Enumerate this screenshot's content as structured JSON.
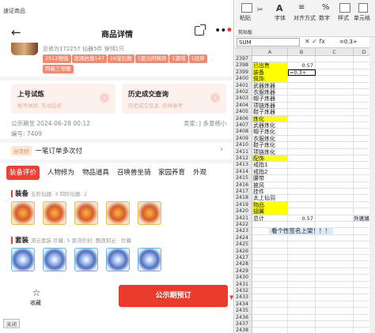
{
  "left": {
    "top_label": "速证商品",
    "header": {
      "title": "商品详情"
    },
    "stats": "总修为172257  仙器5件  穿翎1只",
    "tags": [
      "2512物值",
      "改观抗值147",
      "16宝石数",
      "1套元的佩饰",
      "1游戏",
      "1段穿",
      "四级三觉醒"
    ],
    "cards": [
      {
        "title": "上号试炼",
        "sub": "账号体验, 先试后买"
      },
      {
        "title": "历史成交查询",
        "sub": "历史成交信息, 仅供参考"
      }
    ],
    "publish_time": "公示期至 2024-06-28 00:12",
    "seller": "卖家: J 多意杨小",
    "server": "编号: 7409",
    "install": {
      "badge": "分次付",
      "text": "一笔订单多次付"
    },
    "tabs": [
      "装备评价",
      "人物修为",
      "物品道具",
      "召唤兽坐骑",
      "家园养育",
      "外观"
    ],
    "equip": {
      "title": "装备",
      "sub": "五阶仙器: 3  四阶仙器: 2"
    },
    "set": {
      "title": "套装",
      "sub": "游云套装  珍藏: 5  漱流珍封: 飘逸知云 · 珍藏"
    },
    "bottom": {
      "fav": "收藏",
      "buy": "公示期预订"
    },
    "status": "关闭"
  },
  "right": {
    "ribbon": {
      "paste": "粘贴",
      "clipboard": "剪贴板",
      "font": "字体",
      "align": "对齐方式",
      "number": "数字",
      "style": "样式",
      "cell": "单元格"
    },
    "namebox": "SUM",
    "fx": "✕ ✓ fx",
    "formula": "=0.3+",
    "cols": [
      "A",
      "B",
      "C",
      "D"
    ],
    "rows": [
      {
        "n": "2397",
        "a": "",
        "b": "",
        "y": false
      },
      {
        "n": "2398",
        "a": "已出售",
        "b": "0.57",
        "y": true
      },
      {
        "n": "2399",
        "a": "装备",
        "b": "=0.3+",
        "y": true,
        "edit": true
      },
      {
        "n": "2400",
        "a": "佩饰",
        "b": "",
        "y": true
      },
      {
        "n": "2401",
        "a": "武器炼器",
        "b": "",
        "y": false
      },
      {
        "n": "2402",
        "a": "衣服炼器",
        "b": "",
        "y": false
      },
      {
        "n": "2403",
        "a": "帽子炼器",
        "b": "",
        "y": false
      },
      {
        "n": "2404",
        "a": "项链炼器",
        "b": "",
        "y": false
      },
      {
        "n": "2405",
        "a": "鞋子炼器",
        "b": "",
        "y": false
      },
      {
        "n": "2406",
        "a": "炼化",
        "b": "",
        "y": true
      },
      {
        "n": "2407",
        "a": "武器炼化",
        "b": "",
        "y": false
      },
      {
        "n": "2408",
        "a": "帽子炼化",
        "b": "",
        "y": false
      },
      {
        "n": "2409",
        "a": "衣服炼化",
        "b": "",
        "y": false
      },
      {
        "n": "2410",
        "a": "鞋子炼化",
        "b": "",
        "y": false
      },
      {
        "n": "2411",
        "a": "项链炼化",
        "b": "",
        "y": false
      },
      {
        "n": "2412",
        "a": "配饰",
        "b": "",
        "y": true
      },
      {
        "n": "2413",
        "a": "戒指1",
        "b": "",
        "y": false
      },
      {
        "n": "2414",
        "a": "戒指2",
        "b": "",
        "y": false
      },
      {
        "n": "2415",
        "a": "腰带",
        "b": "",
        "y": false
      },
      {
        "n": "2416",
        "a": "披风",
        "b": "",
        "y": false
      },
      {
        "n": "2417",
        "a": "挂件",
        "b": "",
        "y": false
      },
      {
        "n": "2418",
        "a": "太上仙羽",
        "b": "",
        "y": false
      },
      {
        "n": "2419",
        "a": "物品",
        "b": "",
        "y": true
      },
      {
        "n": "2420",
        "a": "翅翼",
        "b": "",
        "y": true
      },
      {
        "n": "2421",
        "a": "总计",
        "b": "0.57",
        "y": false,
        "d": "外语湖杯"
      },
      {
        "n": "2422",
        "a": "",
        "b": "",
        "y": false
      },
      {
        "n": "2423",
        "a": "",
        "b": "",
        "y": false
      },
      {
        "n": "2424",
        "a": "",
        "b": "",
        "y": false
      },
      {
        "n": "2425",
        "a": "",
        "b": "",
        "y": false
      },
      {
        "n": "2426",
        "a": "",
        "b": "",
        "y": false
      },
      {
        "n": "2427",
        "a": "",
        "b": "",
        "y": false
      },
      {
        "n": "2428",
        "a": "",
        "b": "",
        "y": false
      },
      {
        "n": "2429",
        "a": "",
        "b": "",
        "y": false
      },
      {
        "n": "2430",
        "a": "",
        "b": "",
        "y": false
      },
      {
        "n": "2431",
        "a": "",
        "b": "",
        "y": false
      },
      {
        "n": "2432",
        "a": "",
        "b": "",
        "y": false
      },
      {
        "n": "2433",
        "a": "",
        "b": "",
        "y": false
      },
      {
        "n": "2434",
        "a": "",
        "b": "",
        "y": false
      },
      {
        "n": "2435",
        "a": "",
        "b": "",
        "y": false
      },
      {
        "n": "2436",
        "a": "",
        "b": "",
        "y": false
      },
      {
        "n": "2437",
        "a": "",
        "b": "",
        "y": false
      },
      {
        "n": "2438",
        "a": "",
        "b": "",
        "y": false
      }
    ],
    "note": "看个性签名上架！！！"
  }
}
